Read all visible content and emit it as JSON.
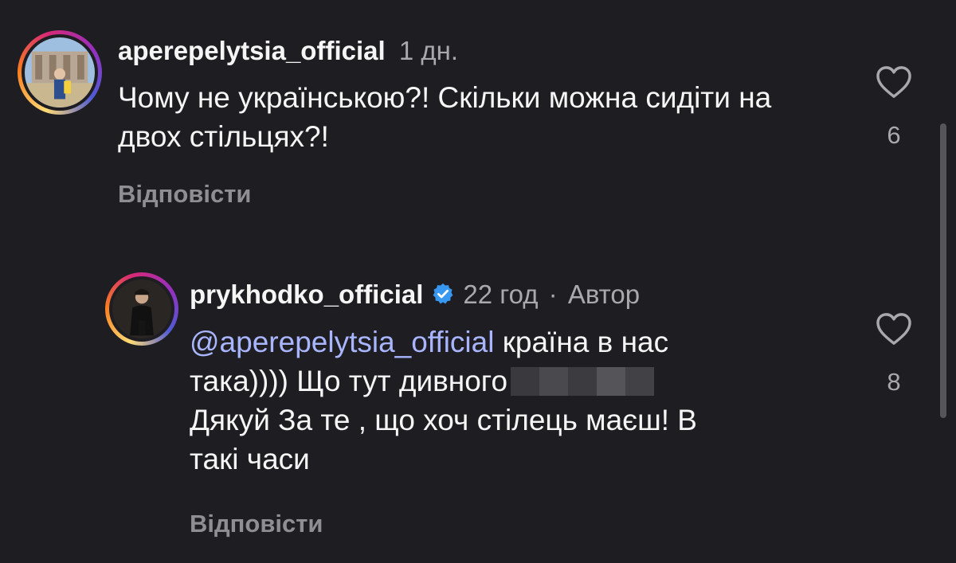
{
  "comments": [
    {
      "username": "aperepelytsia_official",
      "time": "1 дн.",
      "text": "Чому не українською?! Скільки можна сидіти на двох стільцях?!",
      "reply_label": "Відповісти",
      "likes": "6",
      "avatar_icon": "user-photo-icon"
    },
    {
      "username": "prykhodko_official",
      "verified": true,
      "time": "22 год",
      "separator": "·",
      "author_badge": "Автор",
      "mention": "@aperepelytsia_official",
      "text_line1_rest": "країна в нас",
      "text_line2": "така)))) Що тут дивного",
      "text_line3": "Дякуй За те , що хоч стілець маєш! В",
      "text_line4": "такі часи",
      "reply_label": "Відповісти",
      "likes": "8",
      "avatar_icon": "user-photo-icon"
    }
  ],
  "colors": {
    "background": "#1e1e22",
    "mention": "#a9b6ff",
    "muted": "#a8a8ad"
  }
}
